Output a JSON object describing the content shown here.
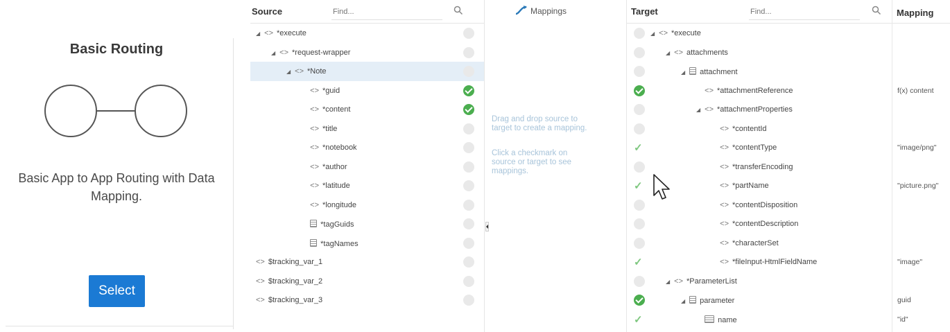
{
  "card": {
    "title": "Basic Routing",
    "description_line1": "Basic App to App Routing with Data",
    "description_line2": "Mapping.",
    "select_label": "Select",
    "accent_color": "#1b7ad4"
  },
  "source": {
    "title": "Source",
    "find_placeholder": "Find...",
    "rows": [
      {
        "indent": 0,
        "expander": "◢",
        "kind": "tag",
        "label": "*execute",
        "status": "empty",
        "selected": false
      },
      {
        "indent": 1,
        "expander": "◢",
        "kind": "tag",
        "label": "*request-wrapper",
        "status": "empty",
        "selected": false
      },
      {
        "indent": 2,
        "expander": "◢",
        "kind": "tag",
        "label": "*Note",
        "status": "empty",
        "selected": true
      },
      {
        "indent": 3,
        "expander": "",
        "kind": "tag",
        "label": "*guid",
        "status": "ok",
        "selected": false
      },
      {
        "indent": 3,
        "expander": "",
        "kind": "tag",
        "label": "*content",
        "status": "ok",
        "selected": false
      },
      {
        "indent": 3,
        "expander": "",
        "kind": "tag",
        "label": "*title",
        "status": "empty",
        "selected": false
      },
      {
        "indent": 3,
        "expander": "",
        "kind": "tag",
        "label": "*notebook",
        "status": "empty",
        "selected": false
      },
      {
        "indent": 3,
        "expander": "",
        "kind": "tag",
        "label": "*author",
        "status": "empty",
        "selected": false
      },
      {
        "indent": 3,
        "expander": "",
        "kind": "tag",
        "label": "*latitude",
        "status": "empty",
        "selected": false
      },
      {
        "indent": 3,
        "expander": "",
        "kind": "tag",
        "label": "*longitude",
        "status": "empty",
        "selected": false
      },
      {
        "indent": 3,
        "expander": "",
        "kind": "list",
        "label": "*tagGuids",
        "status": "empty",
        "selected": false
      },
      {
        "indent": 3,
        "expander": "",
        "kind": "list",
        "label": "*tagNames",
        "status": "empty",
        "selected": false
      },
      {
        "indent": -1,
        "expander": "",
        "kind": "tag",
        "label": "$tracking_var_1",
        "status": "empty",
        "selected": false
      },
      {
        "indent": -1,
        "expander": "",
        "kind": "tag",
        "label": "$tracking_var_2",
        "status": "empty",
        "selected": false
      },
      {
        "indent": -1,
        "expander": "",
        "kind": "tag",
        "label": "$tracking_var_3",
        "status": "empty",
        "selected": false
      }
    ]
  },
  "mappings": {
    "title": "Mappings",
    "hint1_line1": "Drag and drop source to",
    "hint1_line2": "target to create a mapping.",
    "hint2_line1": "Click a checkmark on",
    "hint2_line2": "source or target to see",
    "hint2_line3": "mappings."
  },
  "target": {
    "title": "Target",
    "find_placeholder": "Find...",
    "mapping_header": "Mapping",
    "rows": [
      {
        "indent": 0,
        "expander": "◢",
        "kind": "tag",
        "label": "*execute",
        "status": "empty",
        "mapping": ""
      },
      {
        "indent": 1,
        "expander": "◢",
        "kind": "tag",
        "label": "attachments",
        "status": "empty",
        "mapping": ""
      },
      {
        "indent": 2,
        "expander": "◢",
        "kind": "list",
        "label": "attachment",
        "status": "empty",
        "mapping": ""
      },
      {
        "indent": 3,
        "expander": "",
        "kind": "tag",
        "label": "*attachmentReference",
        "status": "ok",
        "mapping": "f(x) content"
      },
      {
        "indent": 3,
        "expander": "◢",
        "kind": "tag",
        "label": "*attachmentProperties",
        "status": "empty",
        "mapping": ""
      },
      {
        "indent": 4,
        "expander": "",
        "kind": "tag",
        "label": "*contentId",
        "status": "empty",
        "mapping": ""
      },
      {
        "indent": 4,
        "expander": "",
        "kind": "tag",
        "label": "*contentType",
        "status": "tick",
        "mapping": "\"image/png\""
      },
      {
        "indent": 4,
        "expander": "",
        "kind": "tag",
        "label": "*transferEncoding",
        "status": "empty",
        "mapping": ""
      },
      {
        "indent": 4,
        "expander": "",
        "kind": "tag",
        "label": "*partName",
        "status": "tick",
        "mapping": "\"picture.png\""
      },
      {
        "indent": 4,
        "expander": "",
        "kind": "tag",
        "label": "*contentDisposition",
        "status": "empty",
        "mapping": ""
      },
      {
        "indent": 4,
        "expander": "",
        "kind": "tag",
        "label": "*contentDescription",
        "status": "empty",
        "mapping": ""
      },
      {
        "indent": 4,
        "expander": "",
        "kind": "tag",
        "label": "*characterSet",
        "status": "empty",
        "mapping": ""
      },
      {
        "indent": 4,
        "expander": "",
        "kind": "tag",
        "label": "*fileInput-HtmlFieldName",
        "status": "tick",
        "mapping": "\"image\""
      },
      {
        "indent": 1,
        "expander": "◢",
        "kind": "tag",
        "label": "*ParameterList",
        "status": "empty",
        "mapping": ""
      },
      {
        "indent": 2,
        "expander": "◢",
        "kind": "list",
        "label": "parameter",
        "status": "ok",
        "mapping": "guid"
      },
      {
        "indent": 3,
        "expander": "",
        "kind": "field",
        "label": "name",
        "status": "tick",
        "mapping": "\"id\""
      }
    ]
  }
}
